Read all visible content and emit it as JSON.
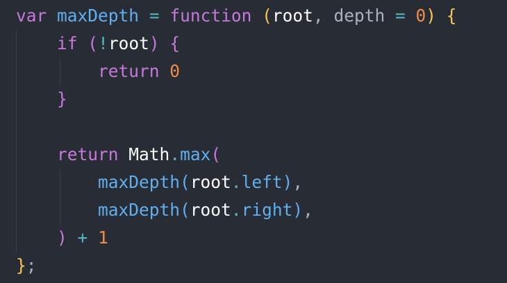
{
  "colors": {
    "background": "#282c34",
    "keyword": "#c678dd",
    "function_name": "#61afef",
    "identifier": "#ffffff",
    "param_muted": "#abb2bf",
    "operator": "#56b6c2",
    "number": "#f08d49",
    "brace_level1": "#f8c555",
    "brace_level2": "#c678dd",
    "brace_level3": "#61afef",
    "punctuation": "#abb2bf",
    "indent_guide": "#3b4048"
  },
  "code": {
    "lines": [
      [
        {
          "t": "var",
          "c": "keyword"
        },
        {
          "t": " ",
          "c": "identifier"
        },
        {
          "t": "maxDepth",
          "c": "function_name"
        },
        {
          "t": " ",
          "c": "identifier"
        },
        {
          "t": "=",
          "c": "operator"
        },
        {
          "t": " ",
          "c": "identifier"
        },
        {
          "t": "function",
          "c": "keyword"
        },
        {
          "t": " ",
          "c": "identifier"
        },
        {
          "t": "(",
          "c": "brace_level1"
        },
        {
          "t": "root",
          "c": "identifier"
        },
        {
          "t": ",",
          "c": "punctuation"
        },
        {
          "t": " ",
          "c": "identifier"
        },
        {
          "t": "depth",
          "c": "param_muted"
        },
        {
          "t": " ",
          "c": "identifier"
        },
        {
          "t": "=",
          "c": "operator"
        },
        {
          "t": " ",
          "c": "identifier"
        },
        {
          "t": "0",
          "c": "number"
        },
        {
          "t": ")",
          "c": "brace_level1"
        },
        {
          "t": " ",
          "c": "identifier"
        },
        {
          "t": "{",
          "c": "brace_level1"
        }
      ],
      [
        {
          "t": "    ",
          "c": "identifier"
        },
        {
          "t": "if",
          "c": "keyword"
        },
        {
          "t": " ",
          "c": "identifier"
        },
        {
          "t": "(",
          "c": "brace_level2"
        },
        {
          "t": "!",
          "c": "operator"
        },
        {
          "t": "root",
          "c": "identifier"
        },
        {
          "t": ")",
          "c": "brace_level2"
        },
        {
          "t": " ",
          "c": "identifier"
        },
        {
          "t": "{",
          "c": "brace_level2"
        }
      ],
      [
        {
          "t": "        ",
          "c": "identifier"
        },
        {
          "t": "return",
          "c": "keyword"
        },
        {
          "t": " ",
          "c": "identifier"
        },
        {
          "t": "0",
          "c": "number"
        }
      ],
      [
        {
          "t": "    ",
          "c": "identifier"
        },
        {
          "t": "}",
          "c": "brace_level2"
        }
      ],
      [],
      [
        {
          "t": "    ",
          "c": "identifier"
        },
        {
          "t": "return",
          "c": "keyword"
        },
        {
          "t": " ",
          "c": "identifier"
        },
        {
          "t": "Math",
          "c": "identifier"
        },
        {
          "t": ".",
          "c": "operator"
        },
        {
          "t": "max",
          "c": "function_name"
        },
        {
          "t": "(",
          "c": "brace_level2"
        }
      ],
      [
        {
          "t": "        ",
          "c": "identifier"
        },
        {
          "t": "maxDepth",
          "c": "function_name"
        },
        {
          "t": "(",
          "c": "brace_level3"
        },
        {
          "t": "root",
          "c": "identifier"
        },
        {
          "t": ".",
          "c": "operator"
        },
        {
          "t": "left",
          "c": "function_name"
        },
        {
          "t": ")",
          "c": "brace_level3"
        },
        {
          "t": ",",
          "c": "punctuation"
        }
      ],
      [
        {
          "t": "        ",
          "c": "identifier"
        },
        {
          "t": "maxDepth",
          "c": "function_name"
        },
        {
          "t": "(",
          "c": "brace_level3"
        },
        {
          "t": "root",
          "c": "identifier"
        },
        {
          "t": ".",
          "c": "operator"
        },
        {
          "t": "right",
          "c": "function_name"
        },
        {
          "t": ")",
          "c": "brace_level3"
        },
        {
          "t": ",",
          "c": "punctuation"
        }
      ],
      [
        {
          "t": "    ",
          "c": "identifier"
        },
        {
          "t": ")",
          "c": "brace_level2"
        },
        {
          "t": " ",
          "c": "identifier"
        },
        {
          "t": "+",
          "c": "operator"
        },
        {
          "t": " ",
          "c": "identifier"
        },
        {
          "t": "1",
          "c": "number"
        }
      ],
      [
        {
          "t": "}",
          "c": "brace_level1"
        },
        {
          "t": ";",
          "c": "punctuation"
        }
      ]
    ]
  }
}
